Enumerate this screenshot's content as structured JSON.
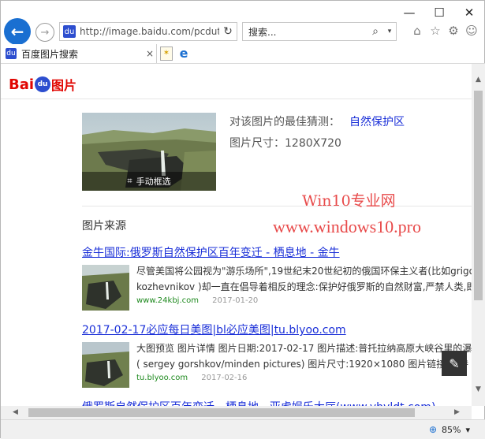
{
  "window": {
    "controls": {
      "minimize": "—",
      "maximize": "☐",
      "close": "✕"
    }
  },
  "nav": {
    "back_icon": "←",
    "forward_icon": "→",
    "address": "http://image.baidu.com/pcdut",
    "refresh_icon": "↻",
    "search_placeholder": "搜索...",
    "search_icon": "⌕",
    "dropdown_icon": "▾",
    "toolbar_icons": {
      "home": "⌂",
      "favorites": "☆",
      "settings": "⚙",
      "smiley": "☺"
    }
  },
  "tab": {
    "title": "百度图片搜索",
    "close": "×"
  },
  "page": {
    "logo": {
      "bai": "Bai",
      "du": "du",
      "tu": "图片"
    },
    "best_guess_label": "对该图片的最佳猜测：",
    "best_guess_value": "自然保护区",
    "size_label": "图片尺寸：1280X720",
    "crop_label": "手动框选",
    "crop_icon": "⌗",
    "source_heading": "图片来源",
    "results": [
      {
        "title": "金牛国际:俄罗斯自然保护区百年变迁 - 栖息地 - 金牛",
        "line1": "尽管美国将公园视为\"游乐场所\",19世纪末20世纪初的俄国环保主义者(比如grigory",
        "line2": "kozhevnikov )却一直在倡导着相反的理念:保护好俄罗斯的自然财富,严禁人类,即便",
        "site": "www.24kbj.com",
        "date": "2017-01-20"
      },
      {
        "title": "2017-02-17必应每日美图|bl必应美图|tu.blyoo.com",
        "line1": "大图预览 图片详情 图片日期:2017-02-17 图片描述:普托拉纳高原大峡谷里的瀑布",
        "line2": "( sergey gorshkov/minden pictures) 图片尺寸:1920×1080 图片链接(支持",
        "site": "tu.blyoo.com",
        "date": "2017-02-16"
      },
      {
        "title": "俄罗斯自然保护区百年变迁 - 栖息地 - 亚虎娱乐大厅(www.yhyldt.com)"
      }
    ],
    "edit_icon": "✎"
  },
  "watermark": {
    "line1": "Win10专业网",
    "line2": "www.windows10.pro"
  },
  "status": {
    "zoom": "85%",
    "zoom_icon": "⊕",
    "zoom_dropdown": "▾"
  }
}
